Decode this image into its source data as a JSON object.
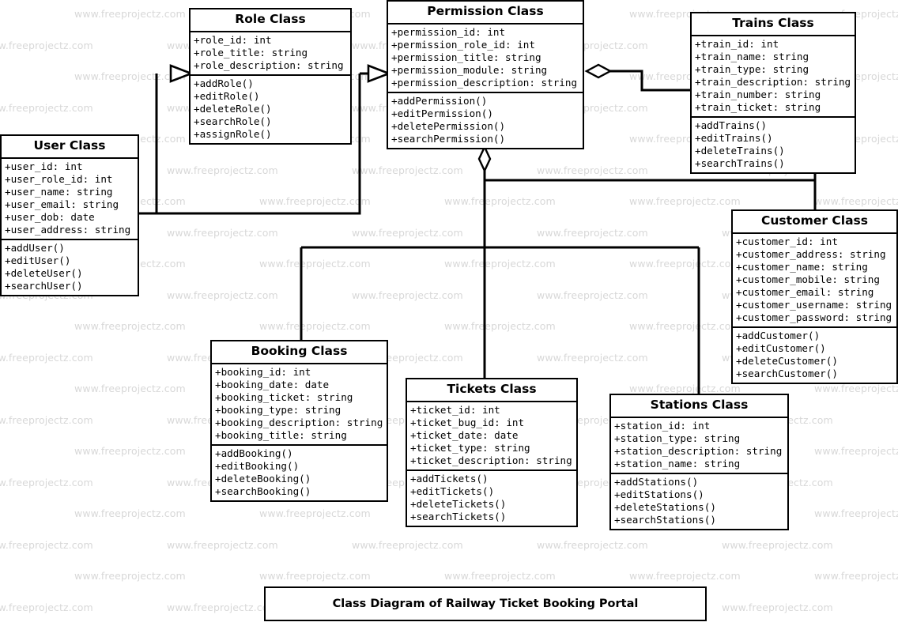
{
  "diagram": {
    "title": "Class Diagram of Railway Ticket Booking Portal",
    "watermark_text": "www.freeprojectz.com",
    "line_color": "#000000",
    "background_color": "#ffffff",
    "watermark_color": "#d8d8d8"
  },
  "classes": {
    "role": {
      "name": "Role Class",
      "attributes": [
        "+role_id: int",
        "+role_title: string",
        "+role_description: string"
      ],
      "methods": [
        "+addRole()",
        "+editRole()",
        "+deleteRole()",
        "+searchRole()",
        "+assignRole()"
      ]
    },
    "permission": {
      "name": "Permission Class",
      "attributes": [
        "+permission_id: int",
        "+permission_role_id: int",
        "+permission_title: string",
        "+permission_module: string",
        "+permission_description: string"
      ],
      "methods": [
        "+addPermission()",
        "+editPermission()",
        "+deletePermission()",
        "+searchPermission()"
      ]
    },
    "trains": {
      "name": "Trains Class",
      "attributes": [
        "+train_id: int",
        "+train_name: string",
        "+train_type: string",
        "+train_description: string",
        "+train_number: string",
        "+train_ticket: string"
      ],
      "methods": [
        "+addTrains()",
        "+editTrains()",
        "+deleteTrains()",
        "+searchTrains()"
      ]
    },
    "user": {
      "name": "User Class",
      "attributes": [
        "+user_id: int",
        "+user_role_id: int",
        "+user_name: string",
        "+user_email: string",
        "+user_dob: date",
        "+user_address: string"
      ],
      "methods": [
        "+addUser()",
        "+editUser()",
        "+deleteUser()",
        "+searchUser()"
      ]
    },
    "customer": {
      "name": "Customer Class",
      "attributes": [
        "+customer_id: int",
        "+customer_address: string",
        "+customer_name: string",
        "+customer_mobile: string",
        "+customer_email: string",
        "+customer_username: string",
        "+customer_password: string"
      ],
      "methods": [
        "+addCustomer()",
        "+editCustomer()",
        "+deleteCustomer()",
        "+searchCustomer()"
      ]
    },
    "booking": {
      "name": "Booking Class",
      "attributes": [
        "+booking_id: int",
        "+booking_date: date",
        "+booking_ticket: string",
        "+booking_type: string",
        "+booking_description: string",
        "+booking_title: string"
      ],
      "methods": [
        "+addBooking()",
        "+editBooking()",
        "+deleteBooking()",
        "+searchBooking()"
      ]
    },
    "tickets": {
      "name": "Tickets Class",
      "attributes": [
        "+ticket_id: int",
        "+ticket_bug_id: int",
        "+ticket_date: date",
        "+ticket_type: string",
        "+ticket_description: string"
      ],
      "methods": [
        "+addTickets()",
        "+editTickets()",
        "+deleteTickets()",
        "+searchTickets()"
      ]
    },
    "stations": {
      "name": "Stations Class",
      "attributes": [
        "+station_id: int",
        "+station_type: string",
        "+station_description: string",
        "+station_name: string"
      ],
      "methods": [
        "+addStations()",
        "+editStations()",
        "+deleteStations()",
        "+searchStations()"
      ]
    }
  }
}
